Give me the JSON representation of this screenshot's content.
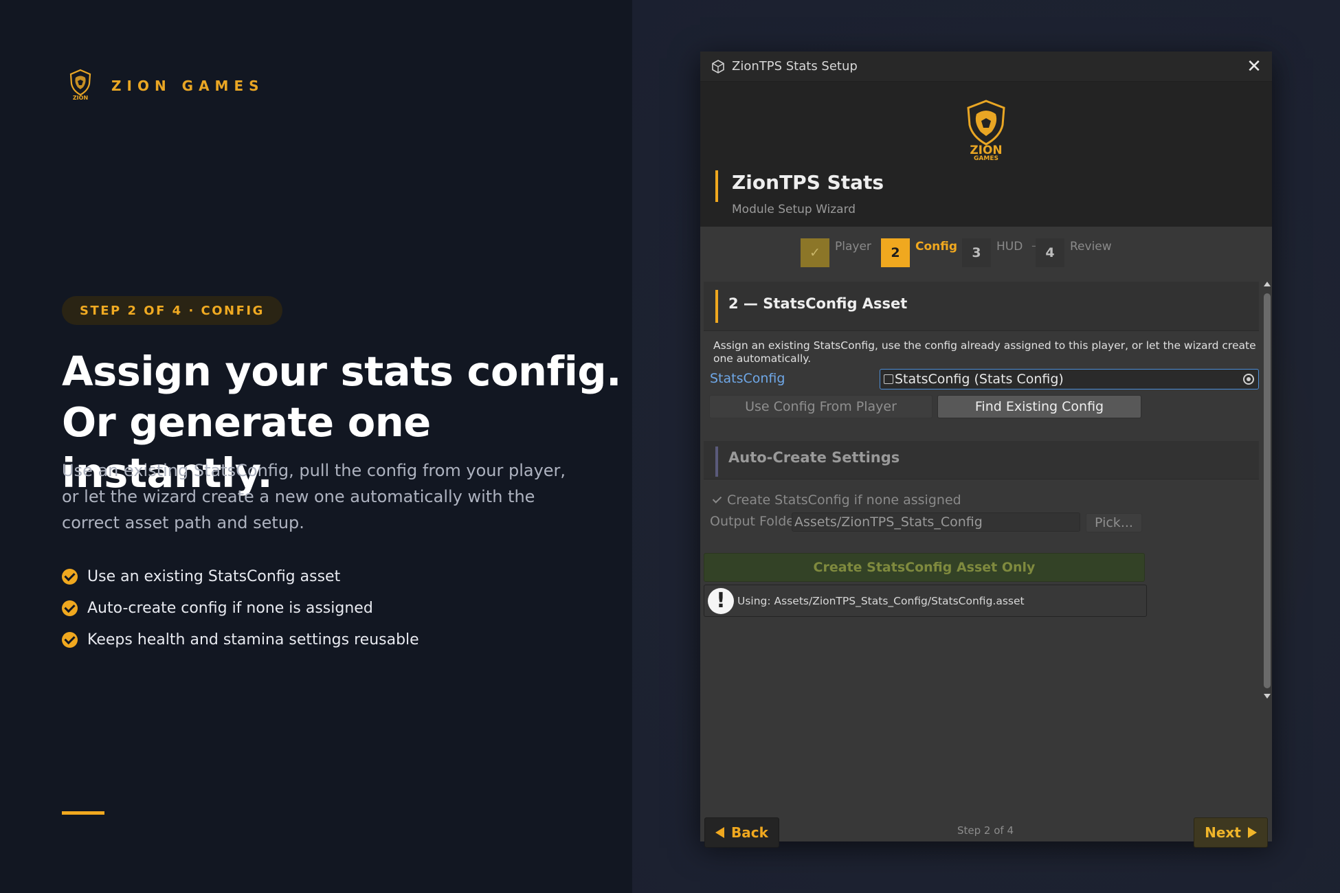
{
  "promo": {
    "brand_name": "ZION GAMES",
    "badge": "STEP 2 OF 4 · CONFIG",
    "headline_line1": "Assign your stats config.",
    "headline_line2": "Or generate one instantly.",
    "body": "Use an existing StatsConfig, pull the config from your player, or let the wizard create a new one automatically with the correct asset path and setup.",
    "bullets": [
      "Use an existing StatsConfig asset",
      "Auto-create config if none is assigned",
      "Keeps health and stamina settings reusable"
    ],
    "accent_color": "#F0A81F"
  },
  "window": {
    "title": "ZionTPS Stats Setup",
    "close_icon": "close-icon",
    "logo_text_top": "ZION",
    "logo_text_bottom": "GAMES",
    "header_title": "ZionTPS Stats",
    "header_subtitle": "Module Setup Wizard",
    "steps": [
      {
        "number": "",
        "label": "Player",
        "state": "done"
      },
      {
        "number": "2",
        "label": "Config",
        "state": "active"
      },
      {
        "number": "3",
        "label": "HUD",
        "state": "pending"
      },
      {
        "number": "4",
        "label": "Review",
        "state": "pending"
      }
    ],
    "step_separator": "—",
    "section1": {
      "title": "2 — StatsConfig Asset",
      "description": "Assign an existing StatsConfig, use the config already assigned to this player, or let the wizard create one automatically.",
      "field_label": "StatsConfig",
      "field_value": "StatsConfig (Stats Config)",
      "btn_use_player": "Use Config From Player",
      "btn_find": "Find Existing Config"
    },
    "section2": {
      "title": "Auto-Create Settings",
      "toggle_label": "Create StatsConfig if none assigned",
      "toggle_checked": true,
      "folder_label": "Output Folder",
      "folder_value": "Assets/ZionTPS_Stats_Config",
      "pick_label": "Pick..."
    },
    "create_button": "Create StatsConfig Asset Only",
    "info_text": "Using: Assets/ZionTPS_Stats_Config/StatsConfig.asset",
    "footer": {
      "back_label": "Back",
      "next_label": "Next",
      "step_info": "Step 2 of 4"
    },
    "colors": {
      "accent": "#F0A81F",
      "link_blue": "#6FA8E8",
      "window_bg": "#383838",
      "header_bg": "#232323"
    }
  }
}
